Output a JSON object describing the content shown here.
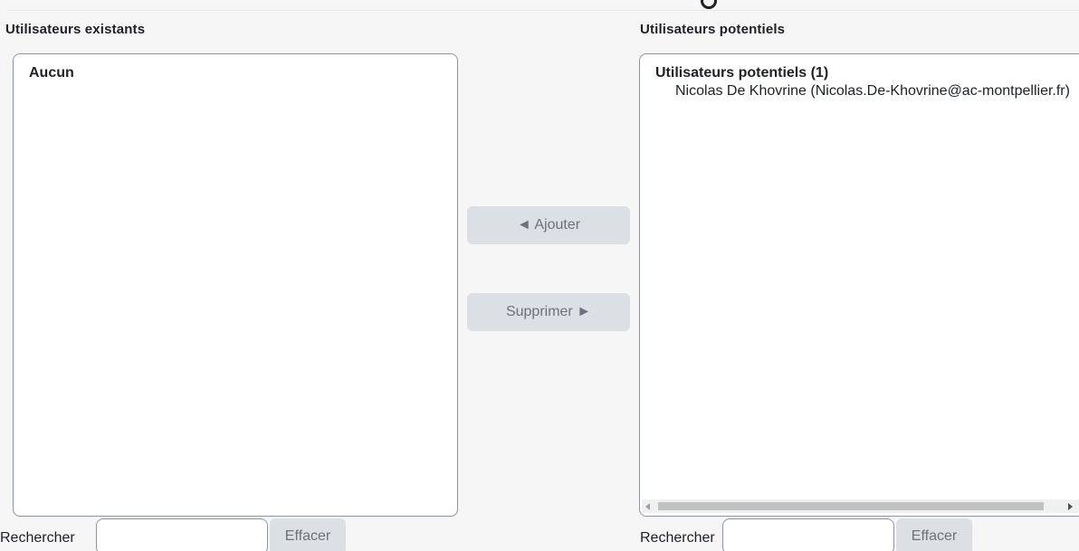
{
  "existing": {
    "label": "Utilisateurs existants",
    "empty_text": "Aucun",
    "search_label": "Rechercher",
    "search_value": "",
    "clear_label": "Effacer"
  },
  "potential": {
    "label": "Utilisateurs potentiels",
    "group_title": "Utilisateurs potentiels (1)",
    "items": [
      {
        "label": "Nicolas De Khovrine (Nicolas.De-Khovrine@ac-montpellier.fr)"
      }
    ],
    "search_label": "Rechercher",
    "search_value": "",
    "clear_label": "Effacer"
  },
  "actions": {
    "add_label": "◄ Ajouter",
    "remove_label": "Supprimer ►"
  }
}
